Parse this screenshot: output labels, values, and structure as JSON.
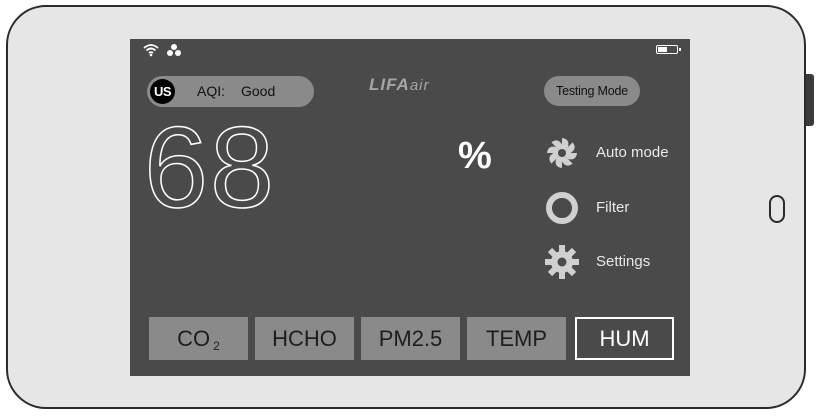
{
  "header": {
    "aqi_standard": "US",
    "aqi_label": "AQI:",
    "aqi_value": "Good",
    "brand_main": "LIFA",
    "brand_sub": "air",
    "testing_mode_label": "Testing Mode"
  },
  "status": {
    "battery_level": 0.55
  },
  "reading": {
    "value": "68",
    "unit": "%"
  },
  "side_menu": [
    {
      "label": "Auto mode",
      "icon": "fan-icon"
    },
    {
      "label": "Filter",
      "icon": "filter-ring-icon"
    },
    {
      "label": "Settings",
      "icon": "gear-icon"
    }
  ],
  "tabs": [
    {
      "label": "CO",
      "sub": "2",
      "active": false
    },
    {
      "label": "HCHO",
      "active": false
    },
    {
      "label": "PM2.5",
      "active": false
    },
    {
      "label": "TEMP",
      "active": false
    },
    {
      "label": "HUM",
      "active": true
    }
  ],
  "colors": {
    "screen_bg": "#4a4a4a",
    "pill_bg": "#8a8a8a",
    "active_tab_border": "#ffffff"
  }
}
